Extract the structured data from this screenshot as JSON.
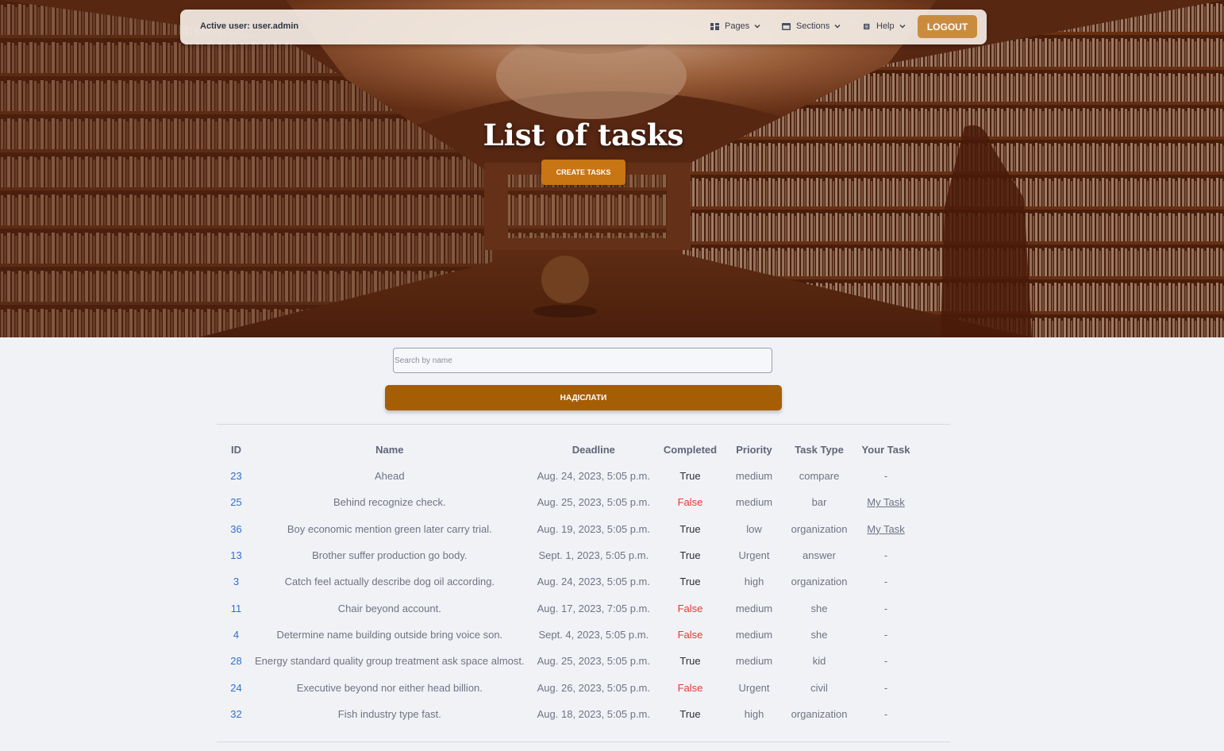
{
  "navbar": {
    "active_user": "Active user: user.admin",
    "menus": [
      {
        "label": "Pages",
        "icon": "grid-icon"
      },
      {
        "label": "Sections",
        "icon": "window-icon"
      },
      {
        "label": "Help",
        "icon": "document-icon"
      }
    ],
    "logout_label": "LOGOUT"
  },
  "hero": {
    "title": "List of tasks",
    "create_label": "CREATE TASKS"
  },
  "search": {
    "placeholder": "Search by name",
    "submit_label": "НАДІСЛАТИ"
  },
  "table": {
    "headers": [
      "ID",
      "Name",
      "Deadline",
      "Completed",
      "Priority",
      "Task Type",
      "Your Task"
    ],
    "rows": [
      {
        "id": "23",
        "name": "Ahead",
        "deadline": "Aug. 24, 2023, 5:05 p.m.",
        "completed": "True",
        "priority": "medium",
        "type": "compare",
        "your": "-"
      },
      {
        "id": "25",
        "name": "Behind recognize check.",
        "deadline": "Aug. 25, 2023, 5:05 p.m.",
        "completed": "False",
        "priority": "medium",
        "type": "bar",
        "your": "My Task"
      },
      {
        "id": "36",
        "name": "Boy economic mention green later carry trial.",
        "deadline": "Aug. 19, 2023, 5:05 p.m.",
        "completed": "True",
        "priority": "low",
        "type": "organization",
        "your": "My Task"
      },
      {
        "id": "13",
        "name": "Brother suffer production go body.",
        "deadline": "Sept. 1, 2023, 5:05 p.m.",
        "completed": "True",
        "priority": "Urgent",
        "type": "answer",
        "your": "-"
      },
      {
        "id": "3",
        "name": "Catch feel actually describe dog oil according.",
        "deadline": "Aug. 24, 2023, 5:05 p.m.",
        "completed": "True",
        "priority": "high",
        "type": "organization",
        "your": "-"
      },
      {
        "id": "11",
        "name": "Chair beyond account.",
        "deadline": "Aug. 17, 2023, 7:05 p.m.",
        "completed": "False",
        "priority": "medium",
        "type": "she",
        "your": "-"
      },
      {
        "id": "4",
        "name": "Determine name building outside bring voice son.",
        "deadline": "Sept. 4, 2023, 5:05 p.m.",
        "completed": "False",
        "priority": "medium",
        "type": "she",
        "your": "-"
      },
      {
        "id": "28",
        "name": "Energy standard quality group treatment ask space almost.",
        "deadline": "Aug. 25, 2023, 5:05 p.m.",
        "completed": "True",
        "priority": "medium",
        "type": "kid",
        "your": "-"
      },
      {
        "id": "24",
        "name": "Executive beyond nor either head billion.",
        "deadline": "Aug. 26, 2023, 5:05 p.m.",
        "completed": "False",
        "priority": "Urgent",
        "type": "civil",
        "your": "-"
      },
      {
        "id": "32",
        "name": "Fish industry type fast.",
        "deadline": "Aug. 18, 2023, 5:05 p.m.",
        "completed": "True",
        "priority": "high",
        "type": "organization",
        "your": "-"
      }
    ]
  },
  "colors": {
    "accent_button": "#c87513",
    "submit_button": "#a65e05",
    "logout_button": "#c98c3f",
    "id_link": "#2f6fd1",
    "false_value": "#e53935"
  }
}
